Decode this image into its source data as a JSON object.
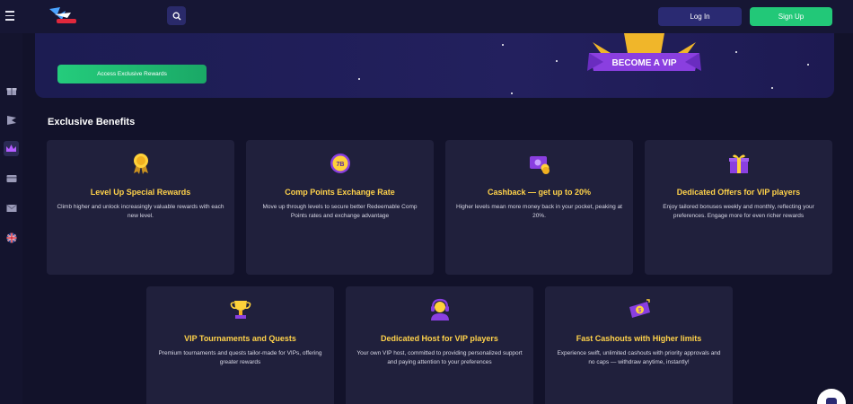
{
  "header": {
    "login_label": "Log In",
    "signup_label": "Sign Up"
  },
  "sidebar": {
    "items": [
      {
        "icon": "gift-icon"
      },
      {
        "icon": "flag-icon"
      },
      {
        "icon": "crown-icon",
        "active": true
      },
      {
        "icon": "card-icon"
      },
      {
        "icon": "mail-icon"
      },
      {
        "icon": "uk-flag-icon"
      }
    ]
  },
  "banner": {
    "cta_label": "Access Exclusive Rewards",
    "badge_text": "BECOME A VIP"
  },
  "section": {
    "title": "Exclusive Benefits"
  },
  "cards": [
    {
      "title": "Level Up Special Rewards",
      "desc": "Climb higher and unlock increasingly valuable rewards with each new level.",
      "icon": "medal-icon"
    },
    {
      "title": "Comp Points Exchange Rate",
      "desc": "Move up through levels to secure better Redeemable Comp Points rates and exchange advantage",
      "icon": "comp-points-icon"
    },
    {
      "title": "Cashback — get up to 20%",
      "desc": "Higher levels mean more money back in your pocket, peaking at 20%.",
      "icon": "cashback-icon"
    },
    {
      "title": "Dedicated Offers for VIP players",
      "desc": "Enjoy tailored bonuses weekly and monthly, reflecting your preferences. Engage more for even richer rewards",
      "icon": "gift-box-icon"
    },
    {
      "title": "VIP Tournaments and Quests",
      "desc": "Premium tournaments and quests tailor-made for VIPs, offering greater rewards",
      "icon": "trophy-icon"
    },
    {
      "title": "Dedicated Host for VIP players",
      "desc": "Your own VIP host, committed to providing personalized support and paying attention to your preferences",
      "icon": "host-icon"
    },
    {
      "title": "Fast Cashouts with Higher limits",
      "desc": "Experience swift, unlimited cashouts with priority approvals and no caps — withdraw anytime, instantly!",
      "icon": "cashout-icon"
    }
  ],
  "colors": {
    "background": "#12122a",
    "card": "#20203c",
    "accent_gold": "#ffd24a",
    "green": "#22c878",
    "purple": "#7a3fd6"
  }
}
